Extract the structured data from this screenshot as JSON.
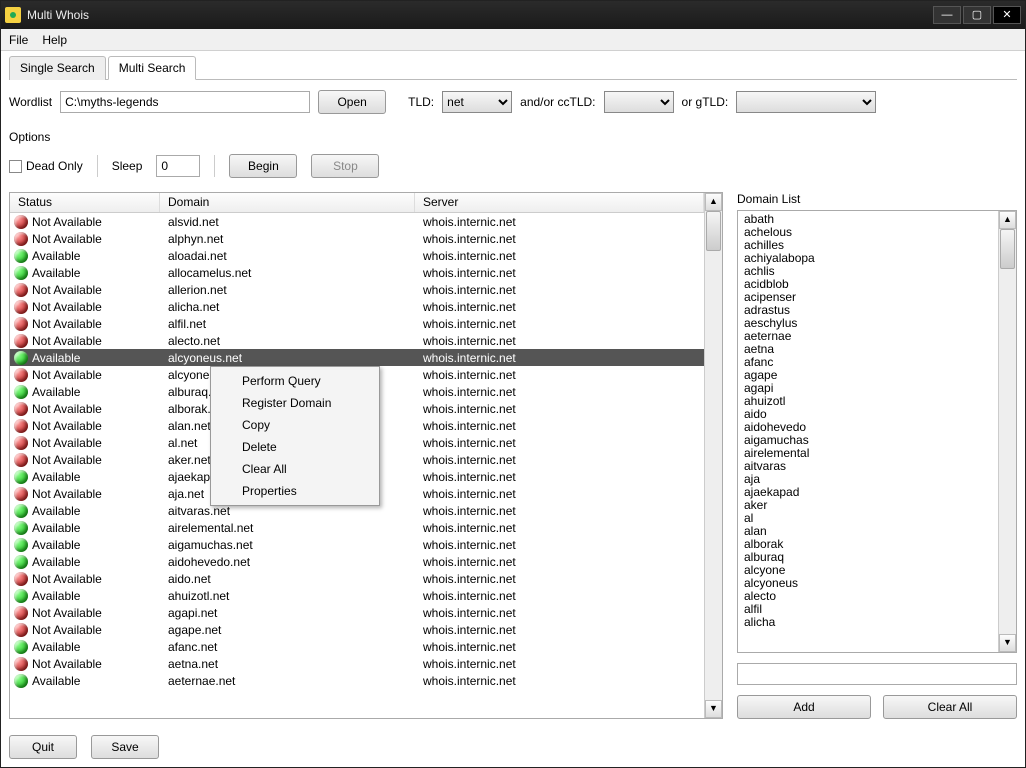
{
  "title": "Multi Whois",
  "menu": {
    "file": "File",
    "help": "Help"
  },
  "tabs": {
    "single": "Single Search",
    "multi": "Multi Search"
  },
  "wordlist": {
    "label": "Wordlist",
    "value": "C:\\myths-legends",
    "open": "Open"
  },
  "tld": {
    "label": "TLD:",
    "value": "net",
    "and": "and/or ccTLD:",
    "or": "or gTLD:"
  },
  "options": {
    "label": "Options",
    "deadonly": "Dead Only",
    "sleep_label": "Sleep",
    "sleep_value": "0",
    "begin": "Begin",
    "stop": "Stop"
  },
  "columns": {
    "status": "Status",
    "domain": "Domain",
    "server": "Server"
  },
  "status": {
    "avail": "Available",
    "notavail": "Not Available"
  },
  "rows": [
    {
      "avail": false,
      "domain": "alsvid.net",
      "server": "whois.internic.net",
      "sel": false
    },
    {
      "avail": false,
      "domain": "alphyn.net",
      "server": "whois.internic.net",
      "sel": false
    },
    {
      "avail": true,
      "domain": "aloadai.net",
      "server": "whois.internic.net",
      "sel": false
    },
    {
      "avail": true,
      "domain": "allocamelus.net",
      "server": "whois.internic.net",
      "sel": false
    },
    {
      "avail": false,
      "domain": "allerion.net",
      "server": "whois.internic.net",
      "sel": false
    },
    {
      "avail": false,
      "domain": "alicha.net",
      "server": "whois.internic.net",
      "sel": false
    },
    {
      "avail": false,
      "domain": "alfil.net",
      "server": "whois.internic.net",
      "sel": false
    },
    {
      "avail": false,
      "domain": "alecto.net",
      "server": "whois.internic.net",
      "sel": false
    },
    {
      "avail": true,
      "domain": "alcyoneus.net",
      "server": "whois.internic.net",
      "sel": true
    },
    {
      "avail": false,
      "domain": "alcyone.net",
      "server": "whois.internic.net",
      "sel": false
    },
    {
      "avail": true,
      "domain": "alburaq.net",
      "server": "whois.internic.net",
      "sel": false
    },
    {
      "avail": false,
      "domain": "alborak.net",
      "server": "whois.internic.net",
      "sel": false
    },
    {
      "avail": false,
      "domain": "alan.net",
      "server": "whois.internic.net",
      "sel": false
    },
    {
      "avail": false,
      "domain": "al.net",
      "server": "whois.internic.net",
      "sel": false
    },
    {
      "avail": false,
      "domain": "aker.net",
      "server": "whois.internic.net",
      "sel": false
    },
    {
      "avail": true,
      "domain": "ajaekapad.net",
      "server": "whois.internic.net",
      "sel": false
    },
    {
      "avail": false,
      "domain": "aja.net",
      "server": "whois.internic.net",
      "sel": false
    },
    {
      "avail": true,
      "domain": "aitvaras.net",
      "server": "whois.internic.net",
      "sel": false
    },
    {
      "avail": true,
      "domain": "airelemental.net",
      "server": "whois.internic.net",
      "sel": false
    },
    {
      "avail": true,
      "domain": "aigamuchas.net",
      "server": "whois.internic.net",
      "sel": false
    },
    {
      "avail": true,
      "domain": "aidohevedo.net",
      "server": "whois.internic.net",
      "sel": false
    },
    {
      "avail": false,
      "domain": "aido.net",
      "server": "whois.internic.net",
      "sel": false
    },
    {
      "avail": true,
      "domain": "ahuizotl.net",
      "server": "whois.internic.net",
      "sel": false
    },
    {
      "avail": false,
      "domain": "agapi.net",
      "server": "whois.internic.net",
      "sel": false
    },
    {
      "avail": false,
      "domain": "agape.net",
      "server": "whois.internic.net",
      "sel": false
    },
    {
      "avail": true,
      "domain": "afanc.net",
      "server": "whois.internic.net",
      "sel": false
    },
    {
      "avail": false,
      "domain": "aetna.net",
      "server": "whois.internic.net",
      "sel": false
    },
    {
      "avail": true,
      "domain": "aeternae.net",
      "server": "whois.internic.net",
      "sel": false
    }
  ],
  "context": {
    "perform": "Perform Query",
    "register": "Register Domain",
    "copy": "Copy",
    "delete": "Delete",
    "clearall": "Clear All",
    "props": "Properties"
  },
  "domainlist": {
    "label": "Domain List",
    "items": [
      "abath",
      "achelous",
      "achilles",
      "achiyalabopa",
      "achlis",
      "acidblob",
      "acipenser",
      "adrastus",
      "aeschylus",
      "aeternae",
      "aetna",
      "afanc",
      "agape",
      "agapi",
      "ahuizotl",
      "aido",
      "aidohevedo",
      "aigamuchas",
      "airelemental",
      "aitvaras",
      "aja",
      "ajaekapad",
      "aker",
      "al",
      "alan",
      "alborak",
      "alburaq",
      "alcyone",
      "alcyoneus",
      "alecto",
      "alfil",
      "alicha"
    ]
  },
  "buttons": {
    "add": "Add",
    "clearall": "Clear All",
    "quit": "Quit",
    "save": "Save"
  }
}
